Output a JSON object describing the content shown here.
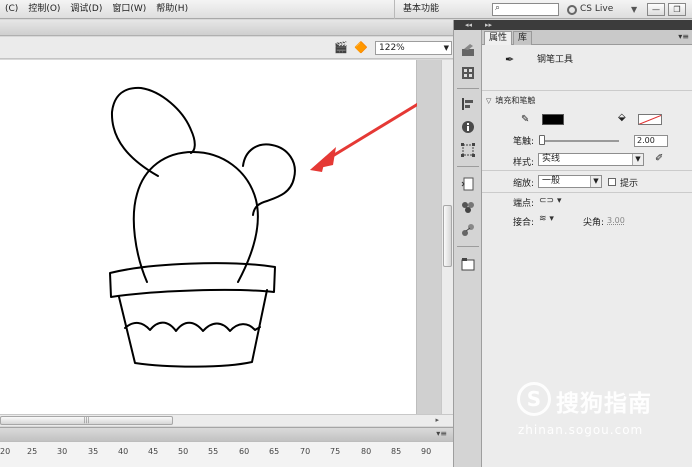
{
  "menu": {
    "items": [
      "(C)",
      "控制(O)",
      "调试(D)",
      "窗口(W)",
      "帮助(H)"
    ],
    "workspace": "基本功能",
    "cs_live": "CS Live"
  },
  "stage": {
    "zoom": "122%"
  },
  "timeline": {
    "ticks": [
      "20",
      "25",
      "30",
      "35",
      "40",
      "45",
      "50",
      "55",
      "60",
      "65",
      "70",
      "75",
      "80",
      "85",
      "90"
    ]
  },
  "panel": {
    "tabs": [
      "属性",
      "库"
    ],
    "tool_name": "钢笔工具",
    "section": "填充和笔触",
    "stroke_label": "笔触:",
    "stroke_value": "2.00",
    "style_label": "样式:",
    "style_value": "实线",
    "scale_label": "缩放:",
    "scale_value": "一般",
    "hint_label": "提示",
    "cap_label": "端点:",
    "join_label": "接合:",
    "miter_label": "尖角:",
    "miter_value": "3.00"
  },
  "watermark": {
    "logo": "S",
    "text": "搜狗指南",
    "url": "zhinan.sogou.com"
  },
  "colors": {
    "stroke_color": "#000000",
    "arrow_color": "#e53935"
  }
}
